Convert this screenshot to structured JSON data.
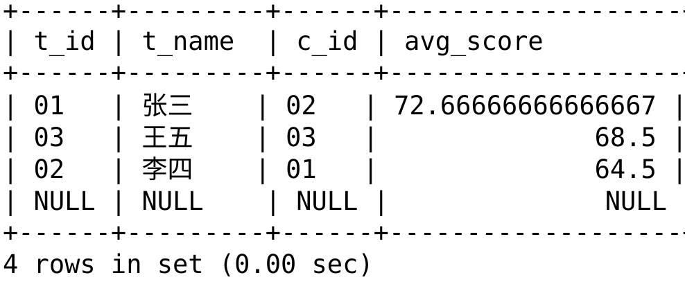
{
  "table": {
    "border_line": "+------+---------+------+-------------------+",
    "headers": [
      "t_id",
      "t_name",
      "c_id",
      "avg_score"
    ],
    "header_line": "| t_id | t_name  | c_id | avg_score         |",
    "rows": [
      {
        "t_id": "01",
        "t_name": "张三",
        "c_id": "02",
        "avg_score": "72.66666666666667"
      },
      {
        "t_id": "03",
        "t_name": "王五",
        "c_id": "03",
        "avg_score": "68.5"
      },
      {
        "t_id": "02",
        "t_name": "李四",
        "c_id": "01",
        "avg_score": "64.5"
      },
      {
        "t_id": "NULL",
        "t_name": "NULL",
        "c_id": "NULL",
        "avg_score": "NULL"
      }
    ],
    "row_lines": [
      "| 01   | 张三    | 02   | 72.66666666666667 |",
      "| 03   | 王五    | 03   |              68.5 |",
      "| 02   | 李四    | 01   |              64.5 |",
      "| NULL | NULL    | NULL |              NULL |"
    ]
  },
  "status": {
    "text": "4 rows in set (0.00 sec)"
  }
}
